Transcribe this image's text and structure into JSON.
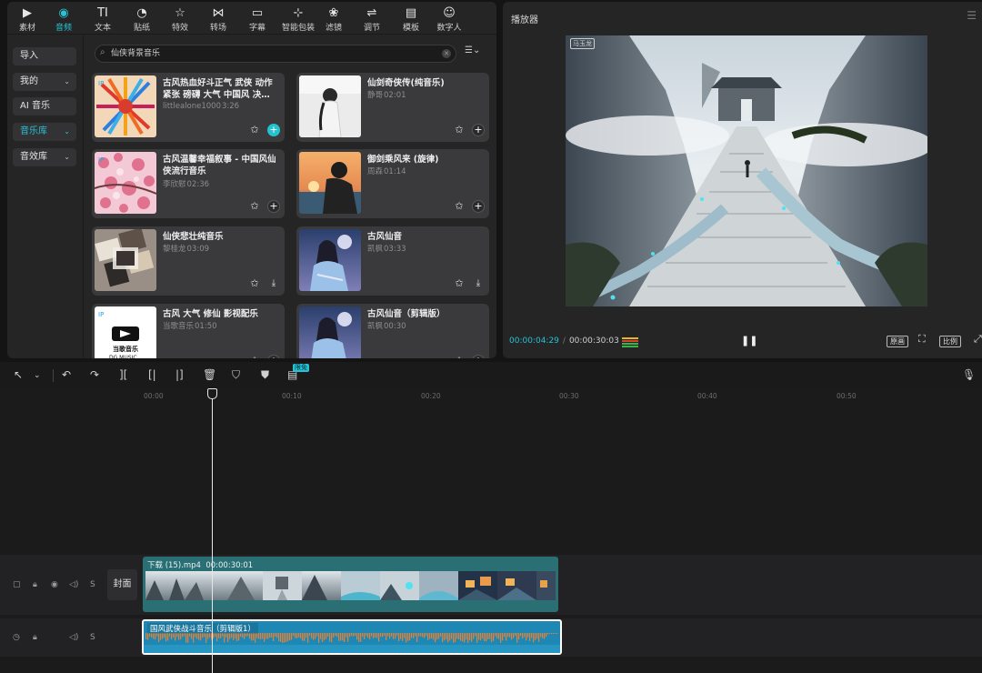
{
  "toolbar": {
    "items": [
      {
        "label": "素材",
        "icon": "media-icon"
      },
      {
        "label": "音频",
        "icon": "audio-icon",
        "active": true
      },
      {
        "label": "文本",
        "icon": "text-icon"
      },
      {
        "label": "贴纸",
        "icon": "sticker-icon"
      },
      {
        "label": "特效",
        "icon": "effects-icon"
      },
      {
        "label": "转场",
        "icon": "transition-icon"
      },
      {
        "label": "字幕",
        "icon": "subtitle-icon"
      },
      {
        "label": "智能包装",
        "icon": "smart-pack-icon"
      },
      {
        "label": "滤镜",
        "icon": "filter-icon"
      },
      {
        "label": "调节",
        "icon": "adjust-icon"
      },
      {
        "label": "模板",
        "icon": "template-icon"
      },
      {
        "label": "数字人",
        "icon": "digital-human-icon"
      }
    ]
  },
  "sidebar": {
    "items": [
      {
        "label": "导入",
        "chevron": false
      },
      {
        "label": "我的",
        "chevron": true
      },
      {
        "label": "AI 音乐",
        "chevron": false
      },
      {
        "label": "音乐库",
        "chevron": true,
        "active": true
      },
      {
        "label": "音效库",
        "chevron": true
      }
    ]
  },
  "search": {
    "value": "仙侠背景音乐"
  },
  "music": [
    {
      "title": "古风热血好斗正气  武侠 动作 紧张 磅礴 大气 中国风  决…",
      "artist": "littlealone1000",
      "duration": "3:26",
      "action": "add-accent"
    },
    {
      "title": "仙剑奇侠传(纯音乐)",
      "artist": "静哥",
      "duration": "02:01",
      "action": "add"
    },
    {
      "title": "古风温馨幸福叙事 - 中国风仙侠流行音乐",
      "artist": "李欣慰",
      "duration": "02:36",
      "action": "add"
    },
    {
      "title": "御剑乘风来 (旋律)",
      "artist": "周森",
      "duration": "01:14",
      "action": "add"
    },
    {
      "title": "仙侠悲壮纯音乐",
      "artist": "黎桂龙",
      "duration": "03:09",
      "action": "download"
    },
    {
      "title": "古风仙音",
      "artist": "凯枫",
      "duration": "03:33",
      "action": "download"
    },
    {
      "title": "古风 大气 修仙 影视配乐",
      "artist": "当歌音乐",
      "duration": "01:50",
      "action": "add"
    },
    {
      "title": "古风仙音（剪辑版）",
      "artist": "凯枫",
      "duration": "00:30",
      "action": "add"
    }
  ],
  "player": {
    "title": "播放器",
    "watermark": "马玉龙",
    "current_time": "00:00:04:29",
    "total_time": "00:00:30:03",
    "btn_original": "原画",
    "btn_ratio": "比例"
  },
  "timeline": {
    "badge": "限免",
    "ruler": [
      "00:00",
      "00:10",
      "00:20",
      "00:30",
      "00:40",
      "00:50"
    ],
    "cover_label": "封面",
    "video_clip": {
      "name": "下载 (15).mp4",
      "duration": "00:00:30:01"
    },
    "audio_clip": {
      "name": "国风武侠战斗音乐（剪辑版1）"
    },
    "track_s": "S"
  },
  "colors": {
    "accent": "#27c2d4",
    "video_clip": "#2a6f74",
    "audio_clip": "#1f87b3"
  }
}
